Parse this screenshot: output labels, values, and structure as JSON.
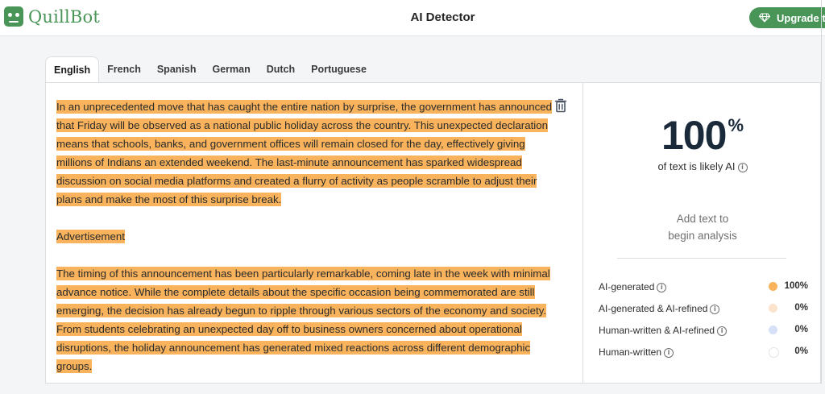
{
  "brand": {
    "name": "QuillBot"
  },
  "header": {
    "title": "AI Detector",
    "upgrade_label": "Upgrade to"
  },
  "tabs": [
    {
      "label": "English",
      "active": true
    },
    {
      "label": "French",
      "active": false
    },
    {
      "label": "Spanish",
      "active": false
    },
    {
      "label": "German",
      "active": false
    },
    {
      "label": "Dutch",
      "active": false
    },
    {
      "label": "Portuguese",
      "active": false
    }
  ],
  "editor": {
    "paragraphs": [
      "In an unprecedented move that has caught the entire nation by surprise, the government has announced that Friday will be observed as a national public holiday across the country. This unexpected declaration means that schools, banks, and government offices will remain closed for the day, effectively giving millions of Indians an extended weekend. The last-minute announcement has sparked widespread discussion on social media platforms and created a flurry of activity as people scramble to adjust their plans and make the most of this surprise break.",
      "Advertisement",
      "The timing of this announcement has been particularly remarkable, coming late in the week with minimal advance notice. While the complete details about the specific occasion being commemorated are still emerging, the decision has already begun to ripple through various sectors of the economy and society. From students celebrating an unexpected day off to business owners concerned about operational disruptions, the holiday announcement has generated mixed reactions across different demographic groups."
    ],
    "highlight_color": "#f8b35c"
  },
  "results": {
    "score_value": "100",
    "score_unit": "%",
    "score_caption": "of text is likely AI",
    "hint_line1": "Add text to",
    "hint_line2": "begin analysis",
    "legend": [
      {
        "label": "AI-generated",
        "value": "100%",
        "color": "#f8b35c"
      },
      {
        "label": "AI-generated & AI-refined",
        "value": "0%",
        "color": "#fbe3cd"
      },
      {
        "label": "Human-written & AI-refined",
        "value": "0%",
        "color": "#d6e1f7"
      },
      {
        "label": "Human-written",
        "value": "0%",
        "color": "#ffffff"
      }
    ]
  },
  "colors": {
    "brand_green": "#499557",
    "score_text": "#1b2a3a"
  }
}
